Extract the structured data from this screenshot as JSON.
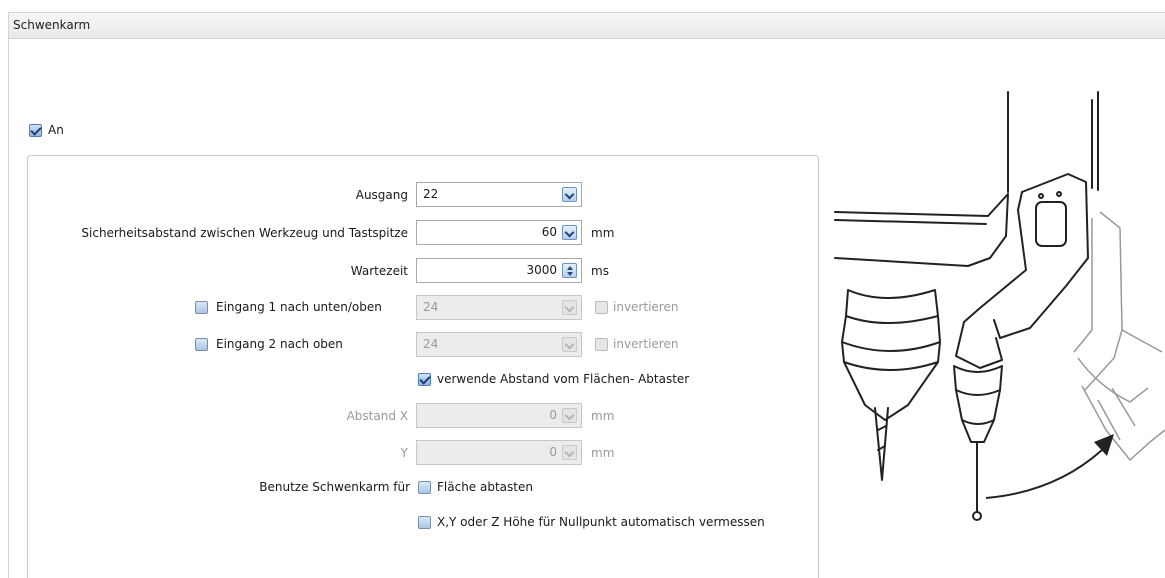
{
  "header": {
    "title": "Schwenkarm"
  },
  "enable": {
    "label": "An",
    "checked": true
  },
  "form": {
    "ausgang": {
      "label": "Ausgang",
      "value": "22"
    },
    "sicherheitsabstand": {
      "label": "Sicherheitsabstand zwischen Werkzeug und Tastspitze",
      "value": "60",
      "unit": "mm"
    },
    "wartezeit": {
      "label": "Wartezeit",
      "value": "3000",
      "unit": "ms"
    },
    "eingang1": {
      "label": "Eingang 1 nach unten/oben",
      "checked": false,
      "value": "24",
      "invert_label": "invertieren",
      "invert_checked": false
    },
    "eingang2": {
      "label": "Eingang 2 nach oben",
      "checked": false,
      "value": "24",
      "invert_label": "invertieren",
      "invert_checked": false
    },
    "verwende_abstand": {
      "label": "verwende Abstand vom Flächen- Abtaster",
      "checked": true
    },
    "abstand_x": {
      "label": "Abstand X",
      "value": "0",
      "unit": "mm"
    },
    "abstand_y": {
      "label": "Y",
      "value": "0",
      "unit": "mm"
    },
    "benutze": {
      "label": "Benutze Schwenkarm für",
      "flaeche": {
        "label": "Fläche abtasten",
        "checked": false
      },
      "nullpunkt": {
        "label": "X,Y oder Z Höhe für Nullpunkt automatisch vermessen",
        "checked": false
      }
    }
  },
  "colors": {
    "checkbox_accent": "#4f7fb6",
    "disabled_text": "#9a9a9a",
    "border": "#c9c9c9"
  },
  "illustration": {
    "icon": "swing-arm-probe-illustration"
  }
}
